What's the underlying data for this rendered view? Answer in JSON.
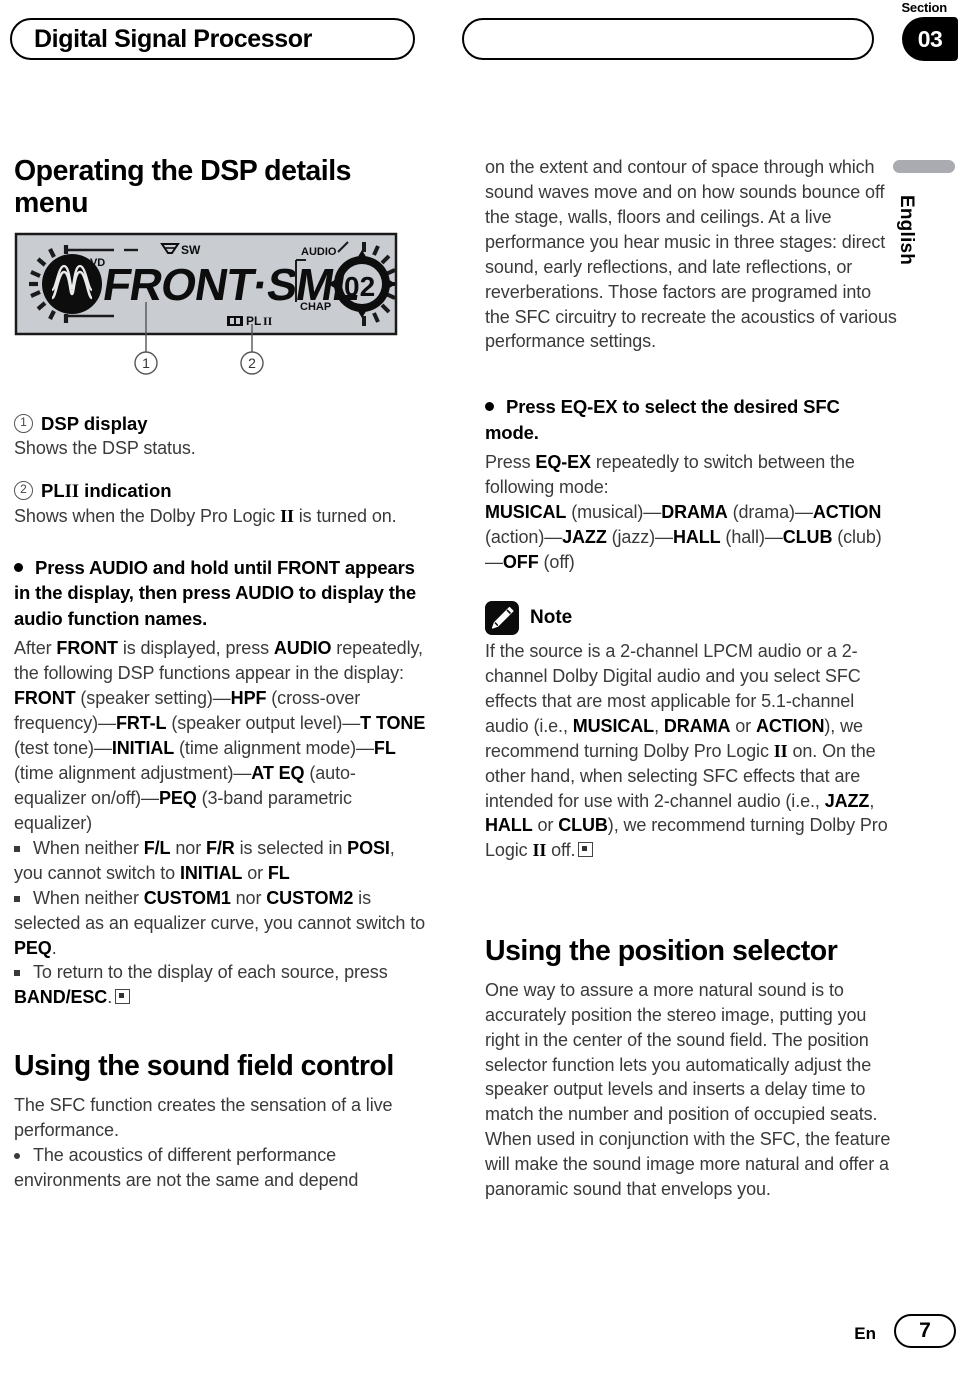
{
  "header": {
    "title": "Digital Signal Processor",
    "section_word": "Section",
    "section_number": "03"
  },
  "side_tab": {
    "language": "English"
  },
  "footer": {
    "lang_code": "En",
    "page_number": "7"
  },
  "left_column": {
    "heading": "Operating the DSP details menu",
    "device_display": {
      "main_text": "FRONT·SML",
      "label_dvd": "DVD",
      "label_sw": "SW",
      "label_audio": "AUDIO",
      "label_chap": "CHAP",
      "label_plii": "PL II",
      "chapter_number": "02",
      "callout_1": "1",
      "callout_2": "2"
    },
    "items": [
      {
        "num": "1",
        "term": "DSP display",
        "desc": "Shows the DSP status."
      },
      {
        "num": "2",
        "term": "PLII indication",
        "desc": "Shows when the Dolby Pro Logic II is turned on."
      }
    ],
    "instruction": "Press AUDIO and hold until FRONT appears in the display, then press AUDIO to display the audio function names.",
    "after_front_intro_1": "After ",
    "after_front_b1": "FRONT",
    "after_front_2": " is displayed, press ",
    "after_front_b2": "AUDIO",
    "after_front_3": " repeatedly, the following DSP functions appear in the display:",
    "function_chain": "FRONT (speaker setting)—HPF (cross-over frequency)—FRT-L (speaker output level)—T TONE (test tone)—INITIAL (time alignment mode)—FL (time alignment adjustment)—AT EQ (auto-equalizer on/off)—PEQ (3-band parametric equalizer)",
    "notes": [
      "When neither F/L nor F/R is selected in POSI, you cannot switch to INITIAL or FL",
      "When neither CUSTOM1 nor CUSTOM2 is selected as an equalizer curve, you cannot switch to PEQ.",
      "To return to the display of each source, press BAND/ESC."
    ],
    "sfc_heading": "Using the sound field control",
    "sfc_intro": "The SFC function creates the sensation of a live performance.",
    "sfc_bullet": "The acoustics of different performance environments are not the same and depend"
  },
  "right_column": {
    "continued_paragraph": "on the extent and contour of space through which sound waves move and on how sounds bounce off the stage, walls, floors and ceilings. At a live performance you hear music in three stages: direct sound, early reflections, and late reflections, or reverberations. Those factors are programed into the SFC circuitry to recreate the acoustics of various performance settings.",
    "eqex_instruction": "Press EQ-EX to select the desired SFC mode.",
    "eqex_body_1": "Press ",
    "eqex_body_b": "EQ-EX",
    "eqex_body_2": " repeatedly to switch between the following mode:",
    "eqex_chain": "MUSICAL (musical)—DRAMA (drama)—ACTION (action)—JAZZ (jazz)—HALL (hall)—CLUB (club)—OFF (off)",
    "note_label": "Note",
    "note_icon": "pencil-icon",
    "note_body": "If the source is a 2-channel LPCM audio or a 2-channel Dolby Digital audio and you select SFC effects that are most applicable for 5.1-channel audio (i.e., MUSICAL, DRAMA or ACTION), we recommend turning Dolby Pro Logic II on. On the other hand, when selecting SFC effects that are intended for use with 2-channel audio (i.e., JAZZ, HALL or CLUB), we recommend turning Dolby Pro Logic II off.",
    "position_heading": "Using the position selector",
    "position_body": "One way to assure a more natural sound is to accurately position the stereo image, putting you right in the center of the sound field. The position selector function lets you automatically adjust the speaker output levels and inserts a delay time to match the number and position of occupied seats. When used in conjunction with the SFC, the feature will make the sound image more natural and offer a panoramic sound that envelops you."
  },
  "colors": {
    "ink": "#000000",
    "body_text": "#3a3a3a",
    "lcd_background": "#c9cdd2",
    "side_tab_bar": "#a9abb0"
  }
}
